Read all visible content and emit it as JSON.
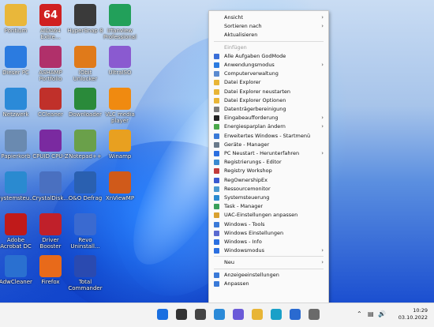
{
  "desktop_icons": [
    {
      "label": "Pontium",
      "icon": "folder-icon"
    },
    {
      "label": "AIDA64\nExtre...",
      "icon": "aida64-icon",
      "glyph": "64"
    },
    {
      "label": "HyperSnap 8",
      "icon": "camera-icon"
    },
    {
      "label": "Irfanview\nProfessional",
      "icon": "irfanview-icon"
    },
    {
      "label": "Dieser PC",
      "icon": "computer-icon"
    },
    {
      "label": "ASHAMP\nPortfolio",
      "icon": "ashampoo-icon"
    },
    {
      "label": "IObit\nUnlocker",
      "icon": "unlocker-icon"
    },
    {
      "label": "UltraISO",
      "icon": "disc-icon"
    },
    {
      "label": "Netzwerk",
      "icon": "network-icon"
    },
    {
      "label": "CCleaner",
      "icon": "ccleaner-icon"
    },
    {
      "label": "Downloader",
      "icon": "downloader-icon"
    },
    {
      "label": "VLC media\nplayer",
      "icon": "vlc-icon"
    },
    {
      "label": "Papierkorb",
      "icon": "recycle-bin-icon"
    },
    {
      "label": "CPUID CPU-Z",
      "icon": "cpuz-icon"
    },
    {
      "label": "Notepad++",
      "icon": "notepad-icon"
    },
    {
      "label": "Winamp",
      "icon": "winamp-icon"
    },
    {
      "label": "Systemsteu...",
      "icon": "control-panel-icon"
    },
    {
      "label": "CrystalDisk...",
      "icon": "crystaldisk-icon"
    },
    {
      "label": "O&O Defrag",
      "icon": "defrag-icon"
    },
    {
      "label": "XnViewMP",
      "icon": "xnview-icon"
    },
    {
      "label": "Adobe\nAcrobat DC",
      "icon": "acrobat-icon"
    },
    {
      "label": "Driver Booster\n10",
      "icon": "driver-booster-icon"
    },
    {
      "label": "Revo\nUninstall...",
      "icon": "revo-icon"
    },
    {
      "label": "",
      "icon": "empty"
    },
    {
      "label": "AdwCleaner",
      "icon": "adwcleaner-icon"
    },
    {
      "label": "Firefox",
      "icon": "firefox-icon"
    },
    {
      "label": "Total\nCommander",
      "icon": "total-commander-icon"
    }
  ],
  "context_menu": {
    "top_items": [
      {
        "label": "Ansicht",
        "submenu": true
      },
      {
        "label": "Sortieren nach",
        "submenu": true
      },
      {
        "label": "Aktualisieren",
        "submenu": false
      }
    ],
    "paste_label": "Einfügen",
    "tools": [
      {
        "label": "Alle Aufgaben GodMode",
        "submenu": false,
        "color": "#3a6fd8"
      },
      {
        "label": "Anwendungsmodus",
        "submenu": true,
        "color": "#2b7be0"
      },
      {
        "label": "Computerverwaltung",
        "submenu": false,
        "color": "#5a8ad0"
      },
      {
        "label": "Datei Explorer",
        "submenu": false,
        "color": "#e8b536"
      },
      {
        "label": "Datei Explorer neustarten",
        "submenu": false,
        "color": "#e8b536"
      },
      {
        "label": "Datei Explorer Optionen",
        "submenu": false,
        "color": "#e8b536"
      },
      {
        "label": "Datenträgerbereinigung",
        "submenu": false,
        "color": "#7a7a7a"
      },
      {
        "label": "Eingabeaufforderung",
        "submenu": true,
        "color": "#222222"
      },
      {
        "label": "Energiesparplan ändern",
        "submenu": true,
        "color": "#4aa84a"
      },
      {
        "label": "Erweitertes Windows - Startmenü",
        "submenu": false,
        "color": "#3a7ad8"
      },
      {
        "label": "Geräte - Manager",
        "submenu": false,
        "color": "#6a7a8a"
      },
      {
        "label": "PC Neustart - Herunterfahren",
        "submenu": true,
        "color": "#2b6fe0"
      },
      {
        "label": "Registrierungs - Editor",
        "submenu": false,
        "color": "#3a8ad0"
      },
      {
        "label": "Registry Workshop",
        "submenu": false,
        "color": "#c23a3a"
      },
      {
        "label": "RegOwnershipEx",
        "submenu": false,
        "color": "#3a5ad0"
      },
      {
        "label": "Ressourcemonitor",
        "submenu": false,
        "color": "#4a9ad0"
      },
      {
        "label": "Systemsteuerung",
        "submenu": false,
        "color": "#2a8ad0"
      },
      {
        "label": "Task - Manager",
        "submenu": false,
        "color": "#3aa05a"
      },
      {
        "label": "UAC-Einstellungen anpassen",
        "submenu": false,
        "color": "#d8a030"
      },
      {
        "label": "Windows - Tools",
        "submenu": false,
        "color": "#3a7ad8"
      },
      {
        "label": "Windows Einstellungen",
        "submenu": false,
        "color": "#5a6ad0"
      },
      {
        "label": "Windows - Info",
        "submenu": false,
        "color": "#2b6fe0"
      },
      {
        "label": "Windowsmodus",
        "submenu": true,
        "color": "#2b6fe0"
      }
    ],
    "new_label": "Neu",
    "bottom_items": [
      {
        "label": "Anzeigeeinstellungen",
        "color": "#3a7ad8"
      },
      {
        "label": "Anpassen",
        "color": "#3a7ad8"
      }
    ]
  },
  "taskbar": {
    "apps": [
      {
        "name": "start-icon",
        "color": "#1a6fe0"
      },
      {
        "name": "search-icon",
        "color": "#333333"
      },
      {
        "name": "task-view-icon",
        "color": "#444444"
      },
      {
        "name": "widgets-icon",
        "color": "#2b8ad8"
      },
      {
        "name": "chat-icon",
        "color": "#6a5ad8"
      },
      {
        "name": "file-explorer-icon",
        "color": "#e8b536"
      },
      {
        "name": "edge-icon",
        "color": "#1aa0c8"
      },
      {
        "name": "store-icon",
        "color": "#2a6ad0"
      },
      {
        "name": "settings-icon",
        "color": "#6a6a6a"
      }
    ],
    "time": "10:29",
    "date": "03.10.2022"
  }
}
